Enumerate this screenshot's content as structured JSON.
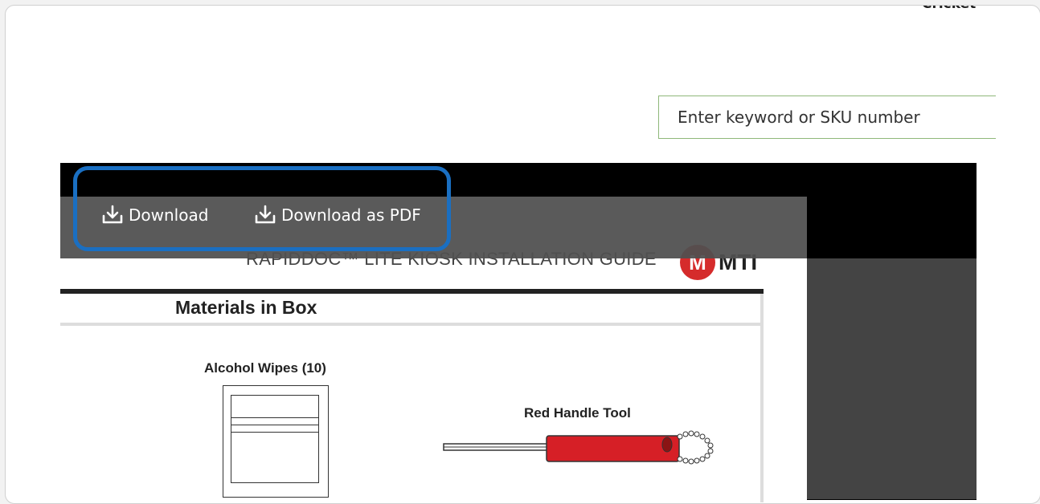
{
  "header": {
    "cut_off_text": "Cricket"
  },
  "search": {
    "placeholder": "Enter keyword or SKU number"
  },
  "viewer": {
    "toolbar": {
      "download_label": "Download",
      "download_pdf_label": "Download as PDF"
    },
    "document": {
      "title": "RAPIDDOC™ LITE KIOSK INSTALLATION GUIDE",
      "logo_mark": "M",
      "logo_text": "MTI",
      "section_title": "Materials in Box",
      "items": [
        {
          "label": "Alcohol Wipes (10)"
        },
        {
          "label": "Red Handle Tool"
        }
      ]
    }
  },
  "colors": {
    "highlight": "#1a6fc2",
    "search_border": "#8fb87a",
    "logo_red": "#d52b2b",
    "tool_red": "#d61f26"
  }
}
